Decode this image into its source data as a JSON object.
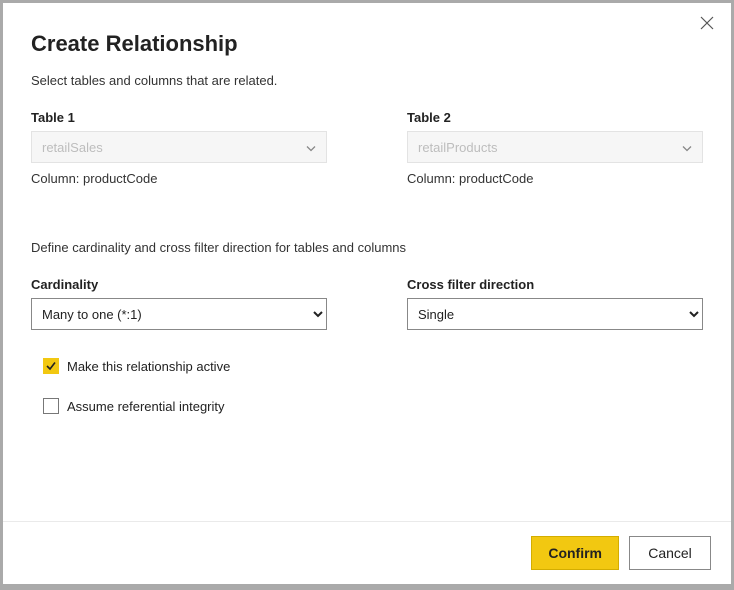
{
  "title": "Create Relationship",
  "subtitle": "Select tables and columns that are related.",
  "table1": {
    "label": "Table 1",
    "value": "retailSales",
    "column_label": "Column:",
    "column_value": "productCode"
  },
  "table2": {
    "label": "Table 2",
    "value": "retailProducts",
    "column_label": "Column:",
    "column_value": "productCode"
  },
  "cardinality_section_help": "Define cardinality and cross filter direction for tables and columns",
  "cardinality": {
    "label": "Cardinality",
    "value": "Many to one (*:1)"
  },
  "cross_filter": {
    "label": "Cross filter direction",
    "value": "Single"
  },
  "checkbox_active": {
    "label": "Make this relationship active",
    "checked": true
  },
  "checkbox_refint": {
    "label": "Assume referential integrity",
    "checked": false
  },
  "buttons": {
    "confirm": "Confirm",
    "cancel": "Cancel"
  }
}
